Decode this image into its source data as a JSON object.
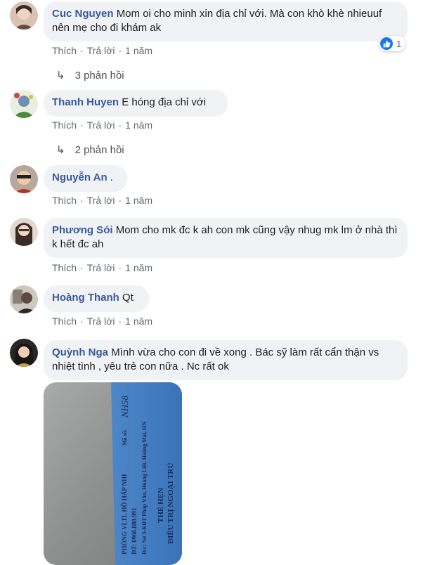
{
  "comments": [
    {
      "name": "Cuc Nguyen",
      "text": "Mom oi cho minh xin địa chỉ với. Mà con khò khè nhieuuf nên mẹ cho đi khám ak",
      "like": "Thích",
      "reply": "Trả lời",
      "time": "1 năm",
      "reaction_count": "1",
      "replies": "3 phản hồi"
    },
    {
      "name": "Thanh Huyen",
      "text": "E hóng địa chỉ với",
      "like": "Thích",
      "reply": "Trả lời",
      "time": "1 năm",
      "replies": "2 phản hồi"
    },
    {
      "name": "Nguyễn An",
      "text": ".",
      "like": "Thích",
      "reply": "Trả lời",
      "time": "1 năm"
    },
    {
      "name": "Phương Sói",
      "text": "Mom cho mk đc k ah con mk cũng vậy nhug mk lm ở nhà thì k hết đc ah",
      "like": "Thích",
      "reply": "Trả lời",
      "time": "1 năm"
    },
    {
      "name": "Hoàng Thanh",
      "text": "Qt",
      "like": "Thích",
      "reply": "Trả lời",
      "time": "1 năm"
    },
    {
      "name": "Quỳnh Nga",
      "text": "Mình vừa cho con đi về xong . Bác sỹ làm rất cẩn thận vs nhiệt tình , yêu trẻ con nữa . Nc rất ok"
    }
  ],
  "separator": "·",
  "photo_card": {
    "line1": "PHÒNG VLTL HỒ HẤP NHI",
    "line2": "ĐT: 0966.880.991",
    "line3": "Đ/c: Nơ 3-KĐT Pháp Vân, Hoàng Liệt, Hoàng Mai, HN",
    "line4": "THẺ HẸN",
    "line5": "ĐIỀU TRỊ NGOẠI TRÚ",
    "code_label": "Mã số:",
    "code_value": "NH58"
  },
  "colors": {
    "name": "#385898",
    "bubble": "#f0f2f5",
    "like": "#1877f2"
  }
}
